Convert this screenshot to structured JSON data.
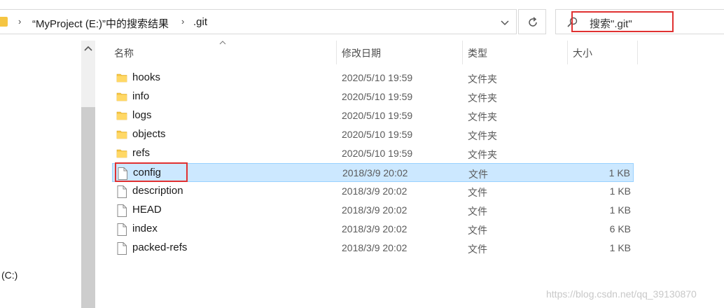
{
  "address_bar": {
    "crumbs": [
      "“MyProject (E:)”中的搜索结果",
      ".git"
    ]
  },
  "search": {
    "text": "搜索\".git\""
  },
  "nav_pane": {
    "drive_label": "(C:)"
  },
  "columns": {
    "name": "名称",
    "modified": "修改日期",
    "type": "类型",
    "size": "大小"
  },
  "files": [
    {
      "name": "hooks",
      "date": "2020/5/10 19:59",
      "type": "文件夹",
      "size": "",
      "kind": "folder",
      "selected": false
    },
    {
      "name": "info",
      "date": "2020/5/10 19:59",
      "type": "文件夹",
      "size": "",
      "kind": "folder",
      "selected": false
    },
    {
      "name": "logs",
      "date": "2020/5/10 19:59",
      "type": "文件夹",
      "size": "",
      "kind": "folder",
      "selected": false
    },
    {
      "name": "objects",
      "date": "2020/5/10 19:59",
      "type": "文件夹",
      "size": "",
      "kind": "folder",
      "selected": false
    },
    {
      "name": "refs",
      "date": "2020/5/10 19:59",
      "type": "文件夹",
      "size": "",
      "kind": "folder",
      "selected": false
    },
    {
      "name": "config",
      "date": "2018/3/9 20:02",
      "type": "文件",
      "size": "1 KB",
      "kind": "file",
      "selected": true
    },
    {
      "name": "description",
      "date": "2018/3/9 20:02",
      "type": "文件",
      "size": "1 KB",
      "kind": "file",
      "selected": false
    },
    {
      "name": "HEAD",
      "date": "2018/3/9 20:02",
      "type": "文件",
      "size": "1 KB",
      "kind": "file",
      "selected": false
    },
    {
      "name": "index",
      "date": "2018/3/9 20:02",
      "type": "文件",
      "size": "6 KB",
      "kind": "file",
      "selected": false
    },
    {
      "name": "packed-refs",
      "date": "2018/3/9 20:02",
      "type": "文件",
      "size": "1 KB",
      "kind": "file",
      "selected": false
    }
  ],
  "watermark": "https://blog.csdn.net/qq_39130870",
  "colors": {
    "selection_bg": "#cce8ff",
    "selection_border": "#99d1ff",
    "annotation_red": "#e03131",
    "folder_yellow": "#f5c542"
  }
}
